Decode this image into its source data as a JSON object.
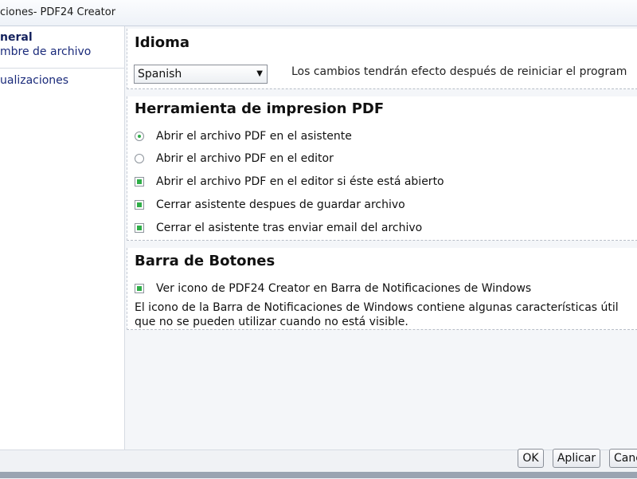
{
  "window": {
    "title": "ciones- PDF24 Creator"
  },
  "sidebar": {
    "items": [
      {
        "label": "neral"
      },
      {
        "label": "mbre de archivo"
      },
      {
        "label": "ualizaciones"
      }
    ]
  },
  "sections": {
    "idioma": {
      "title": "Idioma",
      "select_value": "Spanish",
      "note": "Los cambios tendrán efecto después de reiniciar el program"
    },
    "herramienta": {
      "title": "Herramienta de impresion PDF",
      "options": [
        {
          "label": "Abrir el archivo PDF en el asistente",
          "type": "radio",
          "checked": true
        },
        {
          "label": "Abrir el archivo PDF en el editor",
          "type": "radio",
          "checked": false
        },
        {
          "label": "Abrir el archivo PDF en el editor si éste está abierto",
          "type": "checkbox",
          "checked": true
        },
        {
          "label": "Cerrar asistente despues de guardar archivo",
          "type": "checkbox",
          "checked": true
        },
        {
          "label": "Cerrar el asistente tras enviar email del archivo",
          "type": "checkbox",
          "checked": true
        }
      ]
    },
    "barra": {
      "title": "Barra de Botones",
      "option": {
        "label": "Ver icono de PDF24 Creator en Barra de Notificaciones de Windows",
        "type": "checkbox",
        "checked": true
      },
      "description_line1": "El icono de la Barra de Notificaciones de Windows contiene algunas características útil",
      "description_line2": "que no se pueden utilizar cuando no está visible."
    }
  },
  "buttons": {
    "ok": "OK",
    "apply": "Aplicar",
    "cancel": "Canc"
  },
  "colors": {
    "accent_check": "#2fae48",
    "nav_text": "#1a2a7a"
  }
}
